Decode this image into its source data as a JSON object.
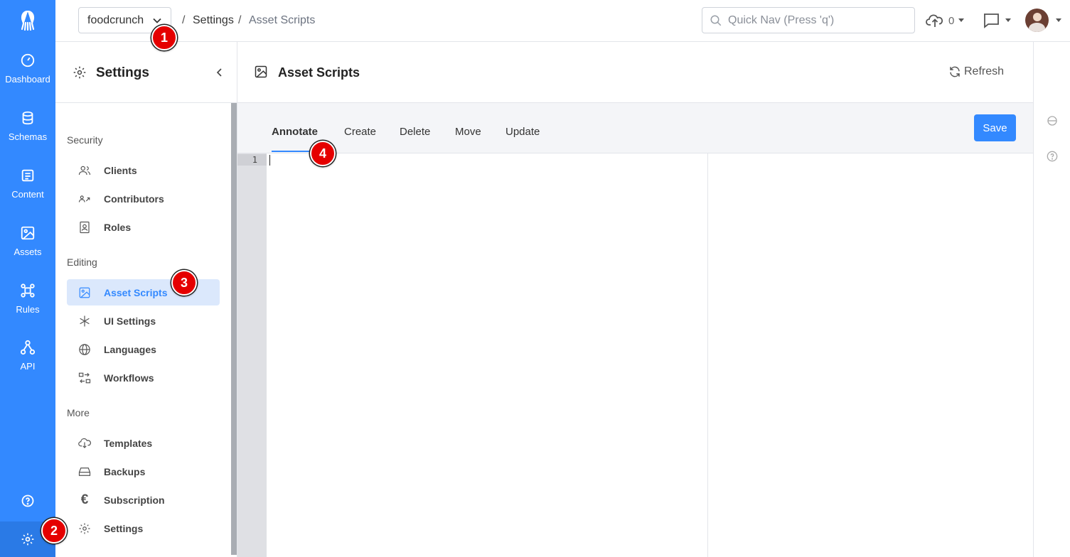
{
  "rail": {
    "items": [
      {
        "label": "Dashboard",
        "icon": "dashboard-icon"
      },
      {
        "label": "Schemas",
        "icon": "schemas-icon"
      },
      {
        "label": "Content",
        "icon": "content-icon"
      },
      {
        "label": "Assets",
        "icon": "assets-icon"
      },
      {
        "label": "Rules",
        "icon": "rules-icon"
      },
      {
        "label": "API",
        "icon": "api-icon"
      }
    ]
  },
  "topbar": {
    "app_name": "foodcrunch",
    "breadcrumb_sep1": "/",
    "breadcrumb_settings": "Settings",
    "breadcrumb_sep2": "/",
    "breadcrumb_current": "Asset Scripts",
    "quicknav_placeholder": "Quick Nav (Press 'q')",
    "upload_count": "0"
  },
  "sidebar": {
    "title": "Settings",
    "groups": {
      "security": "Security",
      "editing": "Editing",
      "more": "More"
    },
    "items": {
      "clients": "Clients",
      "contributors": "Contributors",
      "roles": "Roles",
      "asset_scripts": "Asset Scripts",
      "ui_settings": "UI Settings",
      "languages": "Languages",
      "workflows": "Workflows",
      "templates": "Templates",
      "backups": "Backups",
      "subscription": "Subscription",
      "settings": "Settings"
    }
  },
  "main": {
    "title": "Asset Scripts",
    "refresh_label": "Refresh",
    "save_label": "Save",
    "tabs": [
      "Annotate",
      "Create",
      "Delete",
      "Move",
      "Update"
    ],
    "active_tab": "Annotate",
    "line_number": "1"
  },
  "markers": [
    "1",
    "2",
    "3",
    "4"
  ],
  "colors": {
    "accent": "#3389ff",
    "active_bg": "#dbe8fc",
    "marker": "#e50000"
  }
}
